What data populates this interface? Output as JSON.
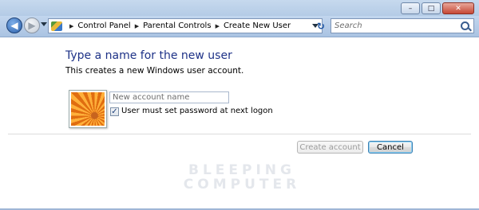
{
  "window": {
    "caption_minimize": "–",
    "caption_maximize": "□",
    "caption_close": "✕"
  },
  "navigation": {
    "back_glyph": "◀",
    "forward_glyph": "▶",
    "breadcrumbs": [
      "Control Panel",
      "Parental Controls",
      "Create New User"
    ],
    "refresh_glyph": "↻"
  },
  "search": {
    "placeholder": "Search"
  },
  "main": {
    "title": "Type a name for the new user",
    "subtitle": "This creates a new Windows user account.",
    "name_input_placeholder": "New account name",
    "name_input_value": "",
    "password_checkbox_checked": true,
    "password_checkbox_glyph": "✓",
    "password_checkbox_label": "User must set password at next logon"
  },
  "buttons": {
    "create_account": "Create account",
    "cancel": "Cancel"
  },
  "watermark": {
    "line1": "BLEEPING",
    "line2": "COMPUTER"
  },
  "icons": {
    "control_panel": "control-panel-icon",
    "search": "search-icon",
    "user_picture": "flower-user-picture"
  },
  "colors": {
    "title_blue": "#1e3287",
    "navbar": "#aac3e2",
    "close_red": "#c64735"
  }
}
